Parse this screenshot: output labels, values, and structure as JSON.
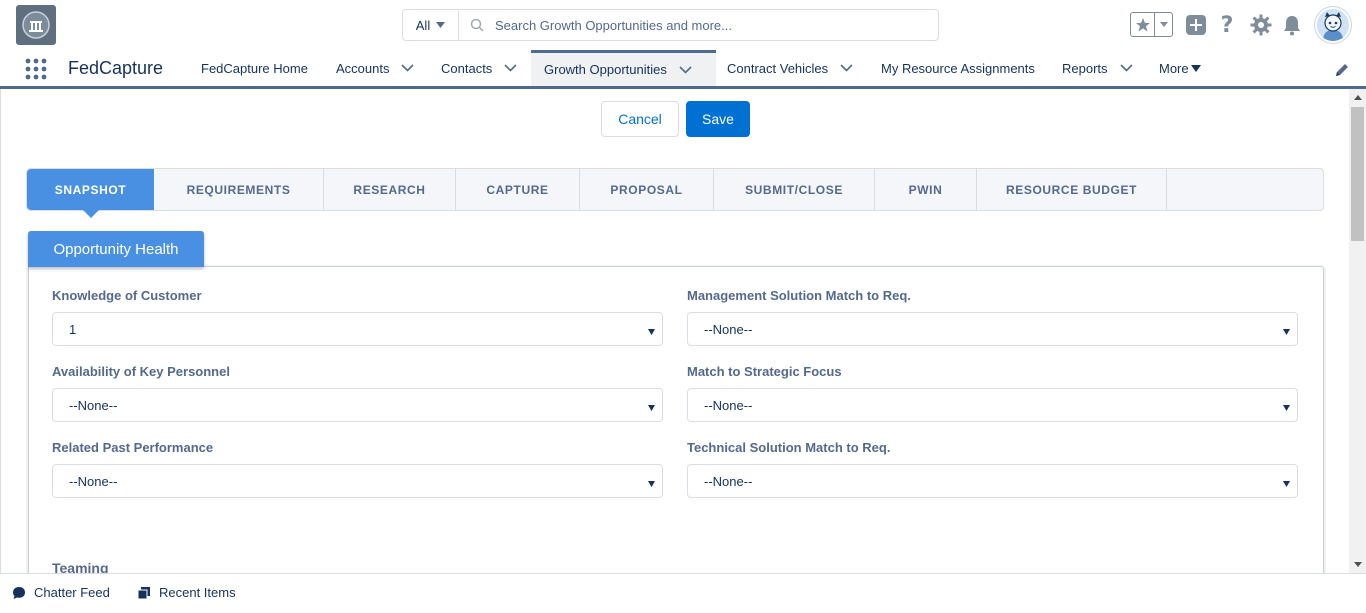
{
  "header": {
    "search_scope": "All",
    "search_placeholder": "Search Growth Opportunities and more..."
  },
  "nav": {
    "app_name": "FedCapture",
    "items": [
      {
        "label": "FedCapture Home"
      },
      {
        "label": "Accounts"
      },
      {
        "label": "Contacts"
      },
      {
        "label": "Growth Opportunities"
      },
      {
        "label": "Contract Vehicles"
      },
      {
        "label": "My Resource Assignments"
      },
      {
        "label": "Reports"
      },
      {
        "label": "More"
      }
    ]
  },
  "actions": {
    "cancel_label": "Cancel",
    "save_label": "Save"
  },
  "tabs": [
    {
      "label": "SNAPSHOT"
    },
    {
      "label": "REQUIREMENTS"
    },
    {
      "label": "RESEARCH"
    },
    {
      "label": "CAPTURE"
    },
    {
      "label": "PROPOSAL"
    },
    {
      "label": "SUBMIT/CLOSE"
    },
    {
      "label": "PWIN"
    },
    {
      "label": "RESOURCE BUDGET"
    }
  ],
  "section": {
    "title": "Opportunity Health",
    "fields": [
      {
        "label": "Knowledge of Customer",
        "value": "1"
      },
      {
        "label": "Management Solution Match to Req.",
        "value": "--None--"
      },
      {
        "label": "Availability of Key Personnel",
        "value": "--None--"
      },
      {
        "label": "Match to Strategic Focus",
        "value": "--None--"
      },
      {
        "label": "Related Past Performance",
        "value": "--None--"
      },
      {
        "label": "Technical Solution Match to Req.",
        "value": "--None--"
      }
    ],
    "next_label": "Teaming"
  },
  "utility": {
    "chatter_label": "Chatter Feed",
    "recent_label": "Recent Items"
  },
  "colors": {
    "brand": "#0070d2",
    "tab_active": "#4a90e2",
    "nav_border": "#4f6a92"
  }
}
